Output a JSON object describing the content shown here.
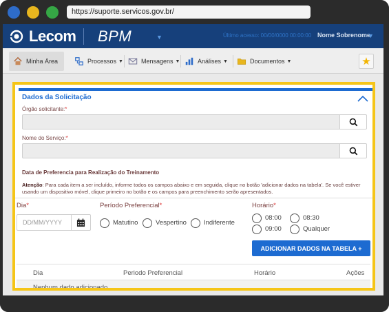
{
  "browser": {
    "url": "https://suporte.servicos.gov.br/"
  },
  "header": {
    "logo_text": "Lecom",
    "product": "BPM",
    "last_access": "Último acesso: 00/00/0000 00:00:00",
    "username": "Nome Sobrenome"
  },
  "nav": {
    "items": [
      {
        "label": "Minha Área",
        "icon": "home-icon"
      },
      {
        "label": "Processos",
        "icon": "processes-icon"
      },
      {
        "label": "Mensagens",
        "icon": "mail-icon"
      },
      {
        "label": "Análises",
        "icon": "chart-icon"
      },
      {
        "label": "Documentos",
        "icon": "folder-icon"
      }
    ],
    "favorite_icon": "star-icon"
  },
  "form": {
    "section_title": "Dados da Solicitação",
    "orgao_label": "Órgão solicitante:",
    "servico_label": "Nome do Serviço:",
    "pref_title": "Data de Preferencia para Realização do Treinamento",
    "note_bold": "Atenção",
    "note_text": ": Para cada item a ser incluído, informe todos os campos abaixo e em seguida, clique no botão 'adicionar dados na tabela'. Se você estiver usando um dispositivo móvel, clique primeiro no botão e os campos para preenchimento serão apresentados.",
    "dia_label": "Dia",
    "dia_placeholder": "DD/MM/YYYY",
    "periodo_label": "Período Preferencial",
    "periodo_options": [
      "Matutino",
      "Vespertino",
      "Indiferente"
    ],
    "horario_label": "Horário",
    "horario_options": [
      "08:00",
      "08:30",
      "09:00",
      "Qualquer"
    ],
    "add_button": "ADICIONAR DADOS NA TABELA +",
    "required_mark": "*"
  },
  "table": {
    "columns": [
      "Dia",
      "Periodo Preferencial",
      "Horário",
      "Ações"
    ],
    "empty_message": "Nenhum dado adicionado"
  },
  "colors": {
    "header_bg": "#16407b",
    "accent": "#1d6bd1",
    "highlight_border": "#f5c518"
  }
}
